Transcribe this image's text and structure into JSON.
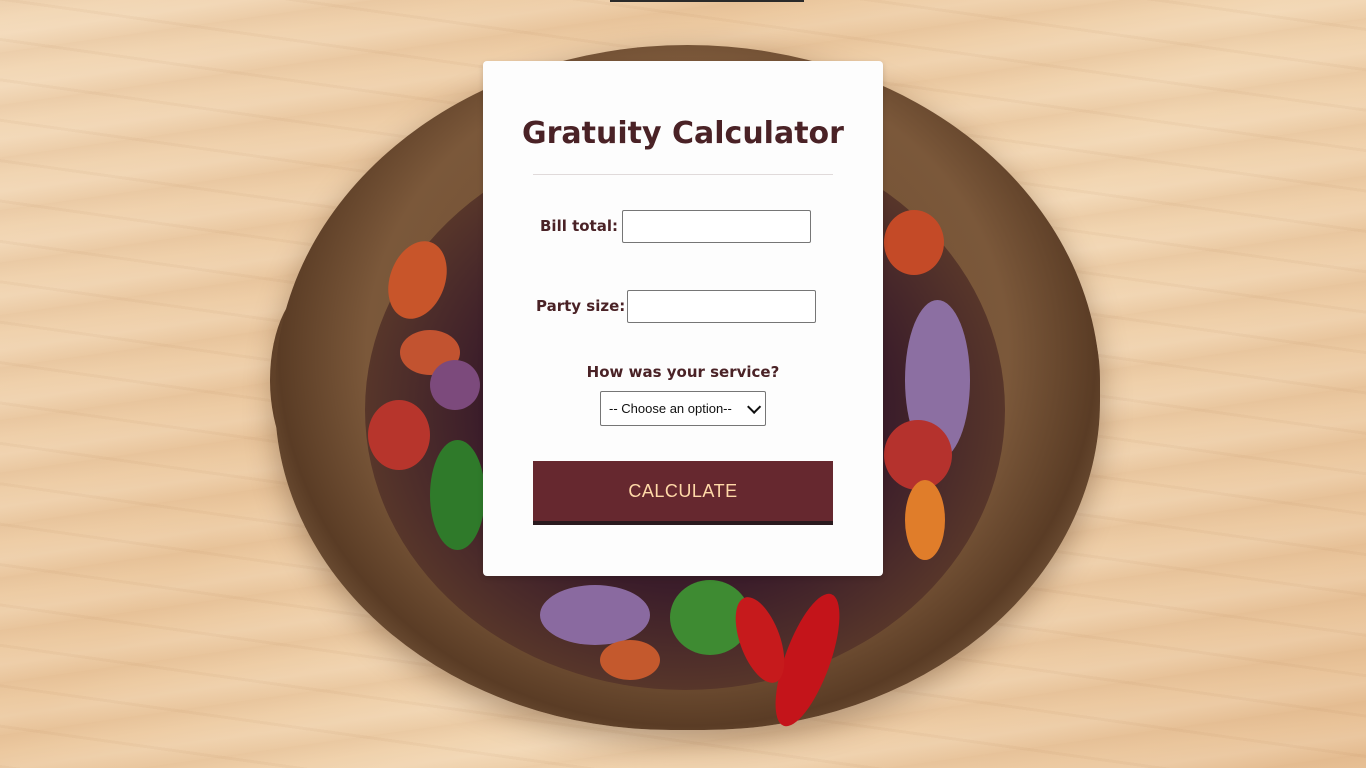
{
  "title": "Gratuity Calculator",
  "form": {
    "bill_label": "Bill total:",
    "bill_value": "",
    "party_label": "Party size:",
    "party_value": "",
    "service_label": "How was your service?",
    "service_selected": "-- Choose an option--",
    "calculate_label": "CALCULATE"
  },
  "colors": {
    "accent": "#66282f",
    "text": "#4a2226",
    "button_text": "#ffd9a8"
  }
}
